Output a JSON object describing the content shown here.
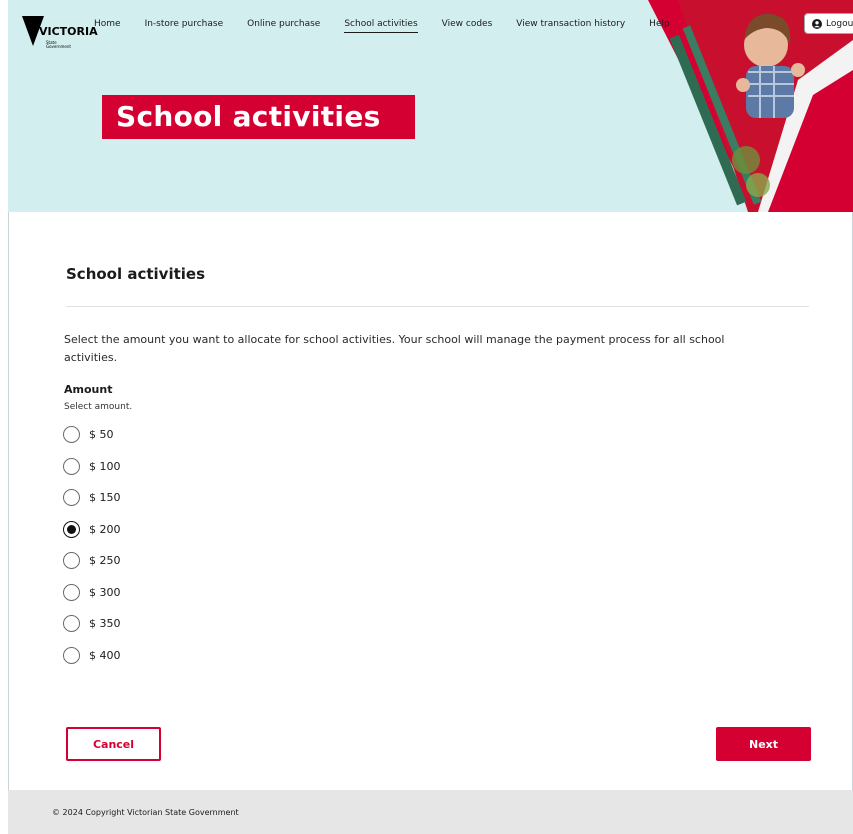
{
  "header": {
    "logo": {
      "wordmark": "VICTORIA",
      "subtitle": "State Government"
    },
    "nav": [
      {
        "label": "Home"
      },
      {
        "label": "In-store purchase"
      },
      {
        "label": "Online purchase"
      },
      {
        "label": "School activities",
        "active": true
      },
      {
        "label": "View codes"
      },
      {
        "label": "View transaction history"
      },
      {
        "label": "Help"
      }
    ],
    "logout_label": "Logout",
    "logout_icon": "user-circle-icon",
    "hero_title": "School activities",
    "hero_image": "child-on-playground-photo"
  },
  "main": {
    "section_title": "School activities",
    "description": "Select the amount you want to allocate for school activities. Your school will manage the payment process for all school activities.",
    "amount_label": "Amount",
    "amount_hint": "Select amount.",
    "options": [
      {
        "label": "$ 50",
        "selected": false
      },
      {
        "label": "$ 100",
        "selected": false
      },
      {
        "label": "$ 150",
        "selected": false
      },
      {
        "label": "$ 200",
        "selected": true
      },
      {
        "label": "$ 250",
        "selected": false
      },
      {
        "label": "$ 300",
        "selected": false
      },
      {
        "label": "$ 350",
        "selected": false
      },
      {
        "label": "$ 400",
        "selected": false
      }
    ],
    "cancel_label": "Cancel",
    "next_label": "Next"
  },
  "footer": {
    "copyright": "© 2024 Copyright Victorian State Government"
  },
  "colors": {
    "brand_red": "#d50032",
    "hero_bg": "#d2eeef",
    "footer_bg": "#e6e6e6"
  }
}
